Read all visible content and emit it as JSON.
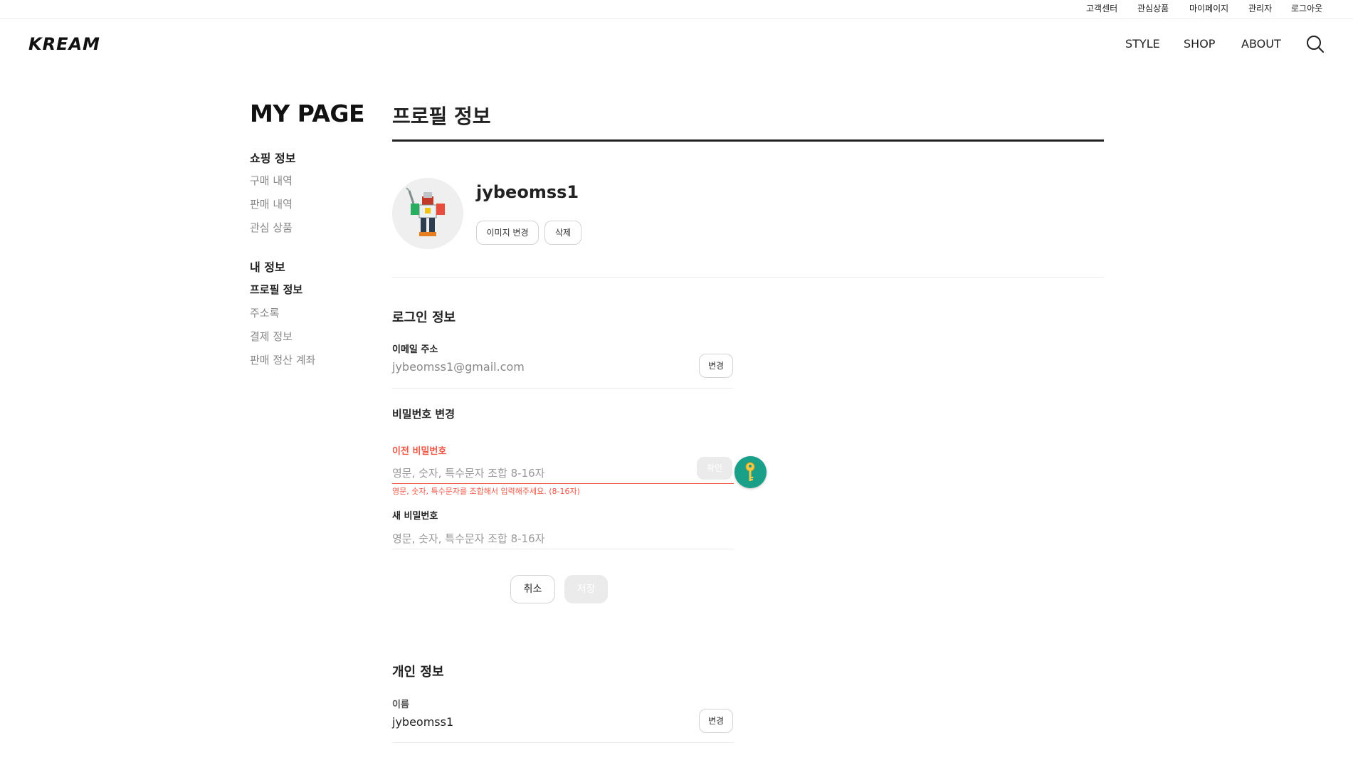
{
  "topbar": {
    "links": [
      "고객센터",
      "관심상품",
      "마이페이지",
      "관리자",
      "로그아웃"
    ]
  },
  "header": {
    "logo": "KREAM",
    "nav": [
      "STYLE",
      "SHOP",
      "ABOUT"
    ],
    "search_icon": "search-icon"
  },
  "sidebar": {
    "title": "MY PAGE",
    "groups": [
      {
        "label": "쇼핑 정보",
        "items": [
          "구매 내역",
          "판매 내역",
          "관심 상품"
        ]
      },
      {
        "label": "내 정보",
        "items": [
          "프로필 정보",
          "주소록",
          "결제 정보",
          "판매 정산 계좌"
        ]
      }
    ],
    "active_item": "프로필 정보"
  },
  "main": {
    "title": "프로필 정보",
    "profile": {
      "name": "jybeomss1",
      "change_image_label": "이미지 변경",
      "delete_label": "삭제"
    },
    "login_info": {
      "title": "로그인 정보",
      "email_label": "이메일 주소",
      "email_value": "jybeomss1@gmail.com",
      "email_change_label": "변경",
      "password_section_title": "비밀번호 변경",
      "old_password_label": "이전 비밀번호",
      "old_password_placeholder": "영문, 숫자, 특수문자 조합 8-16자",
      "confirm_label": "확인",
      "old_password_error": "영문, 숫자, 특수문자를 조합해서 입력해주세요. (8-16자)",
      "new_password_label": "새 비밀번호",
      "new_password_placeholder": "영문, 숫자, 특수문자 조합 8-16자",
      "cancel_label": "취소",
      "save_label": "저장"
    },
    "personal_info": {
      "title": "개인 정보",
      "name_label": "이름",
      "name_value": "jybeomss1",
      "name_change_label": "변경"
    }
  },
  "colors": {
    "accent_error": "#f15746",
    "key_badge": "#1aa089",
    "rule_dark": "#222222"
  }
}
